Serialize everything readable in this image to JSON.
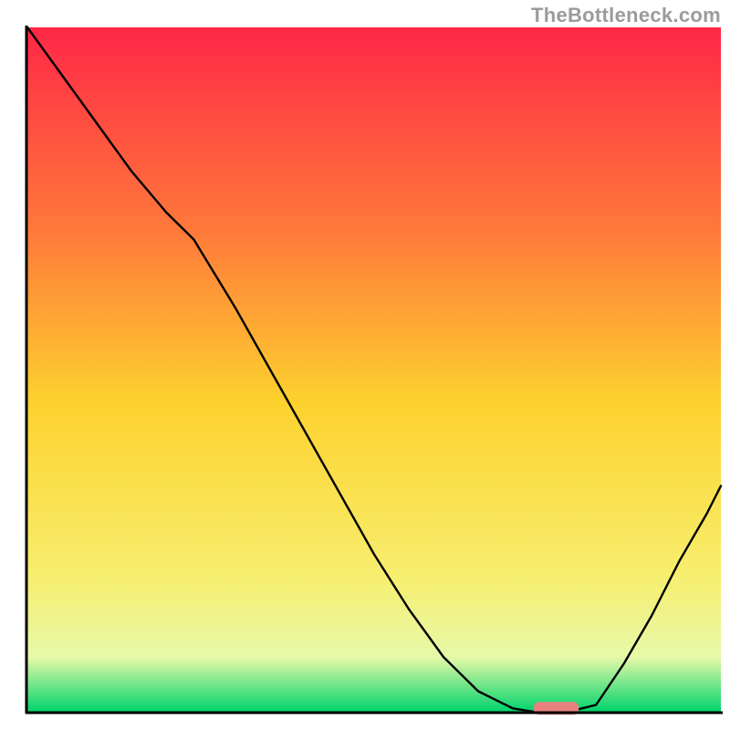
{
  "watermark": "TheBottleneck.com",
  "chart_data": {
    "type": "line",
    "title": "",
    "xlabel": "",
    "ylabel": "",
    "xlim": [
      0,
      1
    ],
    "ylim": [
      0,
      1
    ],
    "x": [
      0.0,
      0.05,
      0.1,
      0.15,
      0.2,
      0.24,
      0.3,
      0.35,
      0.4,
      0.45,
      0.5,
      0.55,
      0.6,
      0.65,
      0.7,
      0.73,
      0.78,
      0.82,
      0.86,
      0.9,
      0.94,
      0.98,
      1.0
    ],
    "values": [
      1.0,
      0.93,
      0.86,
      0.79,
      0.73,
      0.69,
      0.59,
      0.5,
      0.41,
      0.32,
      0.23,
      0.15,
      0.08,
      0.03,
      0.005,
      0.0,
      0.0,
      0.01,
      0.07,
      0.14,
      0.22,
      0.29,
      0.33
    ],
    "marker": {
      "x_start": 0.73,
      "x_end": 0.795,
      "y": 0.005,
      "color": "#e98080"
    },
    "background_gradient": {
      "top": "#ff2747",
      "mid_upper": "#ff7a3a",
      "mid": "#fdd22e",
      "mid_lower": "#f7ee6e",
      "low": "#e7f9a8",
      "bottom": "#00d36b"
    },
    "axes_visible": true,
    "axes_color": "#000000",
    "grid": false
  }
}
